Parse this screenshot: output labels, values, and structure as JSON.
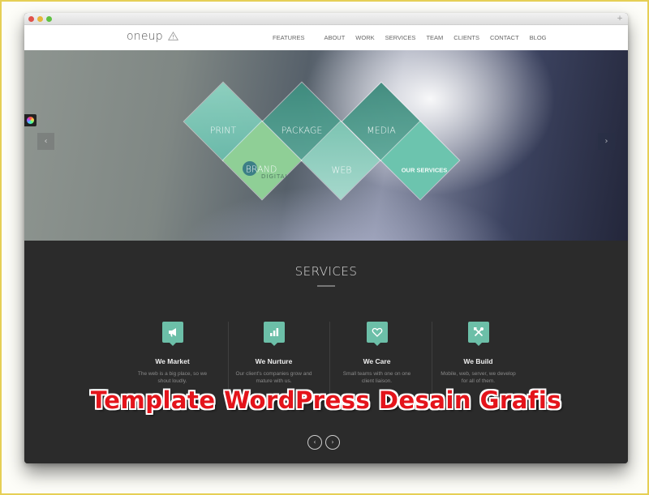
{
  "browser": {
    "traffic_lights": [
      "close",
      "minimize",
      "maximize"
    ],
    "new_tab_label": "+"
  },
  "header": {
    "logo": "oneup",
    "logo_icon": "warning-triangle-icon",
    "nav": [
      "FEATURES",
      "ABOUT",
      "WORK",
      "SERVICES",
      "TEAM",
      "CLIENTS",
      "CONTACT",
      "BLOG"
    ]
  },
  "hero": {
    "prev_arrow": "‹",
    "next_arrow": "›",
    "diamonds": {
      "print": "PRINT",
      "package": "PACKAGE",
      "media": "MEDIA",
      "brand": "BRAND",
      "brand_sub": "DIGITAL",
      "web": "WEB",
      "our_services": "OUR SERVICES"
    }
  },
  "services": {
    "title": "SERVICES",
    "items": [
      {
        "title": "We Market",
        "desc": "The web is a big place, so we shout loudly.",
        "icon": "megaphone-icon"
      },
      {
        "title": "We Nurture",
        "desc": "Our client's companies grow and mature with us.",
        "icon": "bar-chart-icon"
      },
      {
        "title": "We Care",
        "desc": "Small teams with one on one client liaison.",
        "icon": "heart-icon"
      },
      {
        "title": "We Build",
        "desc": "Mobile, web, server, we develop for all of them.",
        "icon": "tools-icon"
      }
    ],
    "pager_prev": "‹",
    "pager_next": "›"
  },
  "overlay_caption": "Template WordPress Desain Grafis",
  "colors": {
    "accent": "#6cbfa8",
    "dark_bg": "#2b2b2b",
    "caption_red": "#e4141b",
    "frame_border": "#e6cf55"
  }
}
